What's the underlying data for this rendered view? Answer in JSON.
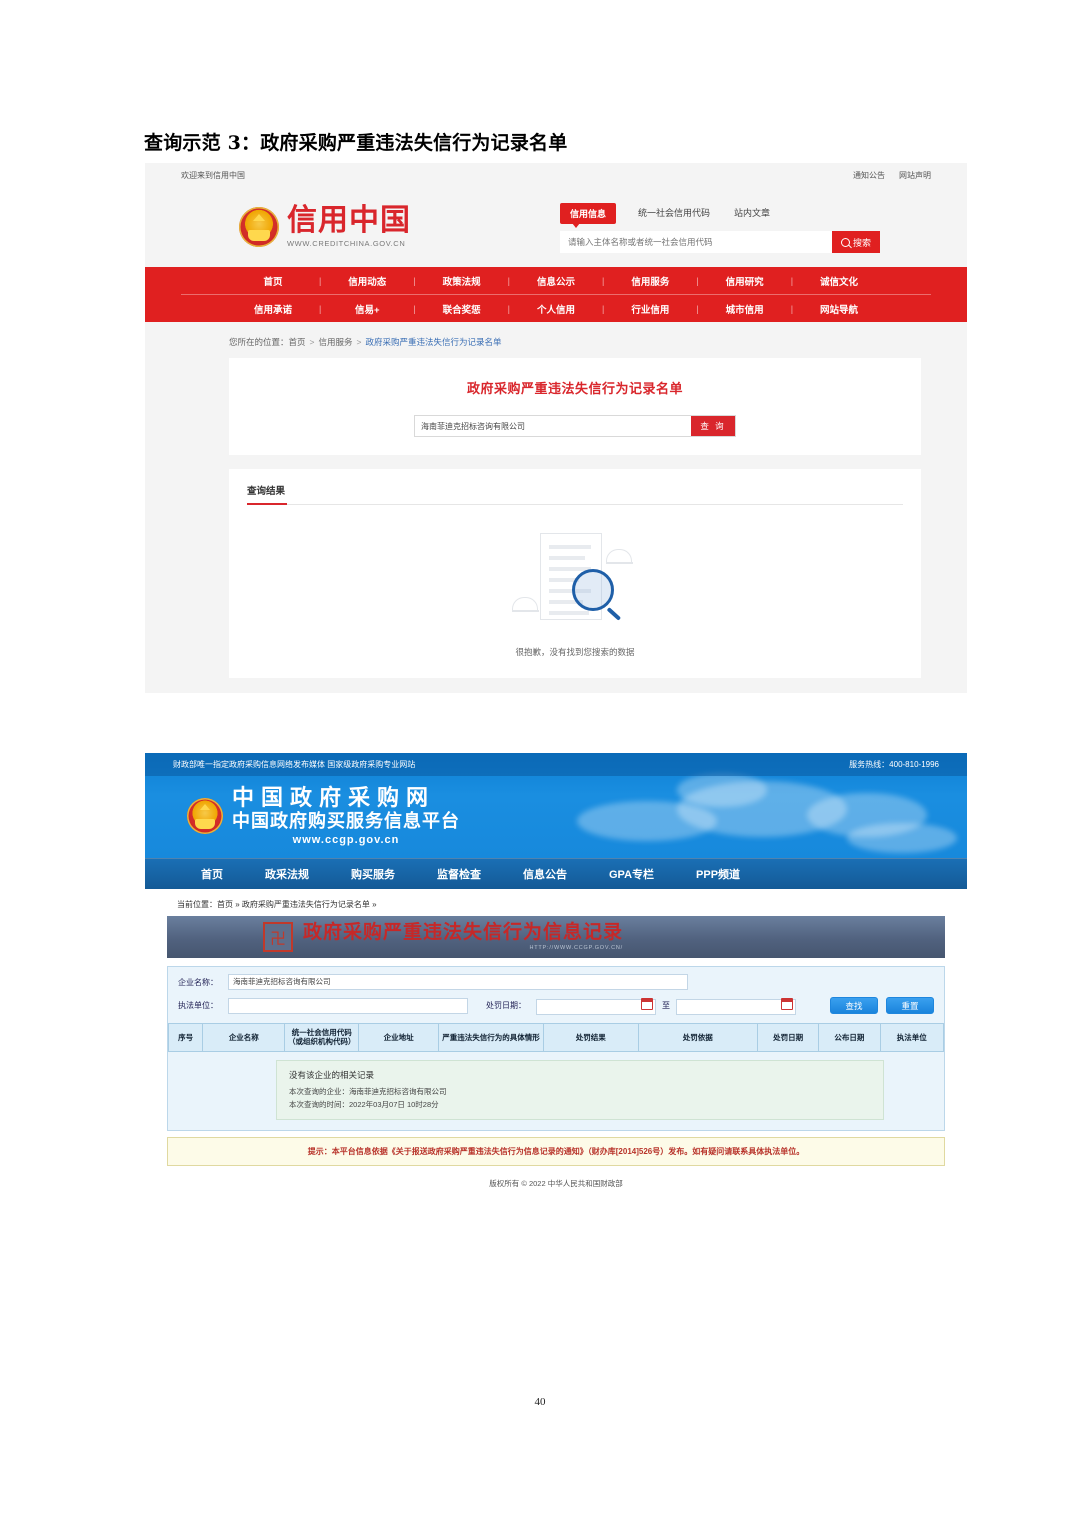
{
  "document": {
    "title": "查询示范 3：政府采购严重违法失信行为记录名单",
    "page_number": "40"
  },
  "shot1": {
    "topbar": {
      "welcome": "欢迎来到信用中国",
      "links": [
        "通知公告",
        "网站声明"
      ]
    },
    "logo": {
      "name": "信用中国",
      "url": "WWW.CREDITCHINA.GOV.CN"
    },
    "search": {
      "tabs": [
        "信用信息",
        "统一社会信用代码",
        "站内文章"
      ],
      "active_tab": "信用信息",
      "placeholder": "请输入主体名称或者统一社会信用代码",
      "value": "",
      "button": "搜索"
    },
    "nav_row1": [
      "首页",
      "信用动态",
      "政策法规",
      "信息公示",
      "信用服务",
      "信用研究",
      "诚信文化"
    ],
    "nav_row2": [
      "信用承诺",
      "信易+",
      "联合奖惩",
      "个人信用",
      "行业信用",
      "城市信用",
      "网站导航"
    ],
    "breadcrumb": {
      "prefix": "您所在的位置：",
      "items": [
        "首页",
        "信用服务"
      ],
      "current": "政府采购严重违法失信行为记录名单"
    },
    "card": {
      "title": "政府采购严重违法失信行为记录名单",
      "input_value": "海南菲迪克招标咨询有限公司",
      "button": "查 询"
    },
    "result": {
      "heading": "查询结果",
      "empty_text": "很抱歉，没有找到您搜索的数据"
    },
    "colors": {
      "brand_red": "#e02020",
      "page_bg": "#f4f4f4"
    }
  },
  "shot2": {
    "topline": {
      "slogan": "财政部唯一指定政府采购信息网络发布媒体 国家级政府采购专业网站",
      "hotline": "服务热线：400-810-1996"
    },
    "logo": {
      "line1": "中国政府采购网",
      "line2": "中国政府购买服务信息平台",
      "line3": "www.ccgp.gov.cn"
    },
    "nav": [
      "首页",
      "政采法规",
      "购买服务",
      "监督检查",
      "信息公告",
      "GPA专栏",
      "PPP频道"
    ],
    "breadcrumb": "当前位置：首页 » 政府采购严重违法失信行为记录名单 »",
    "banner": {
      "title": "政府采购严重违法失信行为信息记录",
      "subtitle": "HTTP://WWW.CCGP.GOV.CN/"
    },
    "form": {
      "company_label": "企业名称：",
      "company_value": "海南菲迪克招标咨询有限公司",
      "unit_label": "执法单位：",
      "unit_value": "",
      "date_label": "处罚日期：",
      "date_start": "",
      "date_end": "",
      "date_separator": "至",
      "search_button": "查找",
      "reset_button": "重置"
    },
    "table": {
      "headers": [
        "序号",
        "企业名称",
        "统一社会信用代码（或组织机构代码）",
        "企业地址",
        "严重违法失信行为的具体情形",
        "处罚结果",
        "处罚依据",
        "处罚日期",
        "公布日期",
        "执法单位"
      ],
      "rows": []
    },
    "message": {
      "title": "没有该企业的相关记录",
      "line1": "本次查询的企业：海南菲迪克招标咨询有限公司",
      "line2": "本次查询的时间：2022年03月07日 10时28分"
    },
    "notice": "提示：本平台信息依据《关于报送政府采购严重违法失信行为信息记录的通知》（财办库[2014]526号）发布。如有疑问请联系具体执法单位。",
    "footer": "版权所有 © 2022 中华人民共和国财政部",
    "colors": {
      "header_blue": "#1789dc",
      "nav_blue": "#145a96",
      "banner_slate": "#51627f",
      "banner_red": "#c62828"
    }
  }
}
